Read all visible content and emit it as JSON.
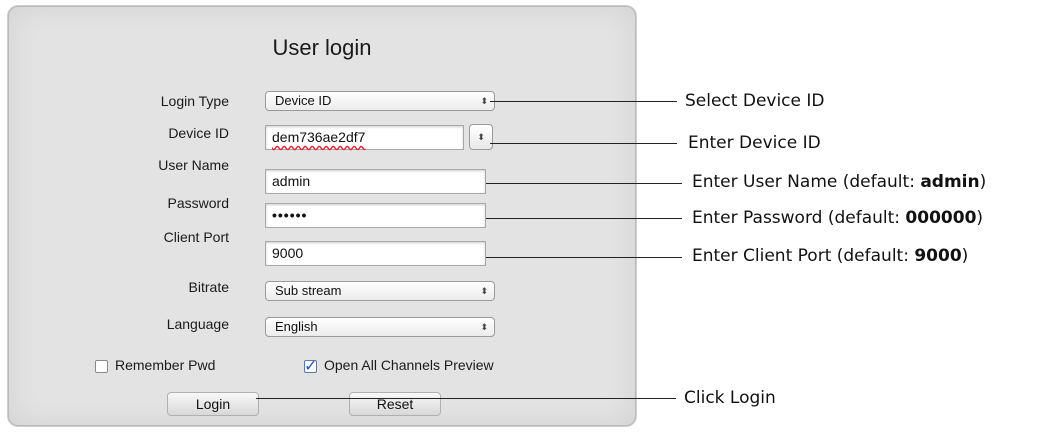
{
  "dialog": {
    "title": "User login",
    "fields": {
      "login_type": {
        "label": "Login Type",
        "value": "Device ID"
      },
      "device_id": {
        "label": "Device ID",
        "value": "dem736ae2df7"
      },
      "user_name": {
        "label": "User Name",
        "value": "admin"
      },
      "password": {
        "label": "Password",
        "value": "••••••"
      },
      "client_port": {
        "label": "Client Port",
        "value": "9000"
      },
      "bitrate": {
        "label": "Bitrate",
        "value": "Sub stream"
      },
      "language": {
        "label": "Language",
        "value": "English"
      }
    },
    "remember_pwd": {
      "label": "Remember Pwd",
      "checked": false
    },
    "open_all_channels": {
      "label": "Open All Channels Preview",
      "checked": true
    },
    "buttons": {
      "login": "Login",
      "reset": "Reset"
    },
    "stepper_glyph": "⬍"
  },
  "callouts": {
    "select_device_id": "Select Device ID",
    "enter_device_id": "Enter Device ID",
    "enter_user_name": {
      "text": "Enter User Name (default: ",
      "bold": "admin",
      "end": ")"
    },
    "enter_password": {
      "text": "Enter Password (default: ",
      "bold": "000000",
      "end": ")"
    },
    "enter_client_port": {
      "text": "Enter Client Port (default: ",
      "bold": "9000",
      "end": ")"
    },
    "click_login": "Click Login"
  }
}
